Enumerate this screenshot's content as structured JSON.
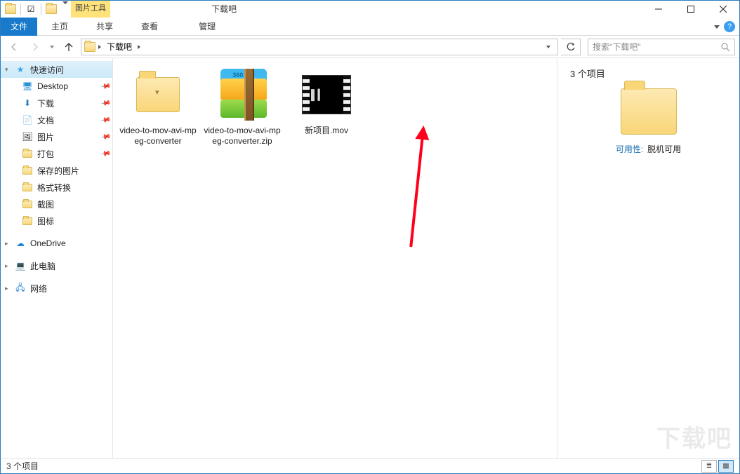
{
  "title_context_group": "图片工具",
  "window_title": "下载吧",
  "ribbon": {
    "file": "文件",
    "tabs": [
      "主页",
      "共享",
      "查看"
    ],
    "context_tab": "管理"
  },
  "address": {
    "segments": [
      "下载吧"
    ]
  },
  "search": {
    "placeholder": "搜索\"下载吧\""
  },
  "sidebar": {
    "quick_access": "快速访问",
    "items": [
      {
        "label": "Desktop",
        "pinned": true
      },
      {
        "label": "下载",
        "pinned": true
      },
      {
        "label": "文档",
        "pinned": true
      },
      {
        "label": "图片",
        "pinned": true
      },
      {
        "label": "打包",
        "pinned": true
      },
      {
        "label": "保存的图片",
        "pinned": false
      },
      {
        "label": "格式转换",
        "pinned": false
      },
      {
        "label": "截图",
        "pinned": false
      },
      {
        "label": "图标",
        "pinned": false
      }
    ],
    "onedrive": "OneDrive",
    "this_pc": "此电脑",
    "network": "网络"
  },
  "files": [
    {
      "name": "video-to-mov-avi-mpeg-converter",
      "kind": "folder"
    },
    {
      "name": "video-to-mov-avi-mpeg-converter.zip",
      "kind": "zip",
      "zip_badge": "360\nZIP"
    },
    {
      "name": "新项目.mov",
      "kind": "video"
    }
  ],
  "details": {
    "count_label": "3 个项目",
    "avail_key": "可用性:",
    "avail_val": "脱机可用"
  },
  "status": {
    "count": "3 个项目"
  },
  "watermark": "下载吧"
}
